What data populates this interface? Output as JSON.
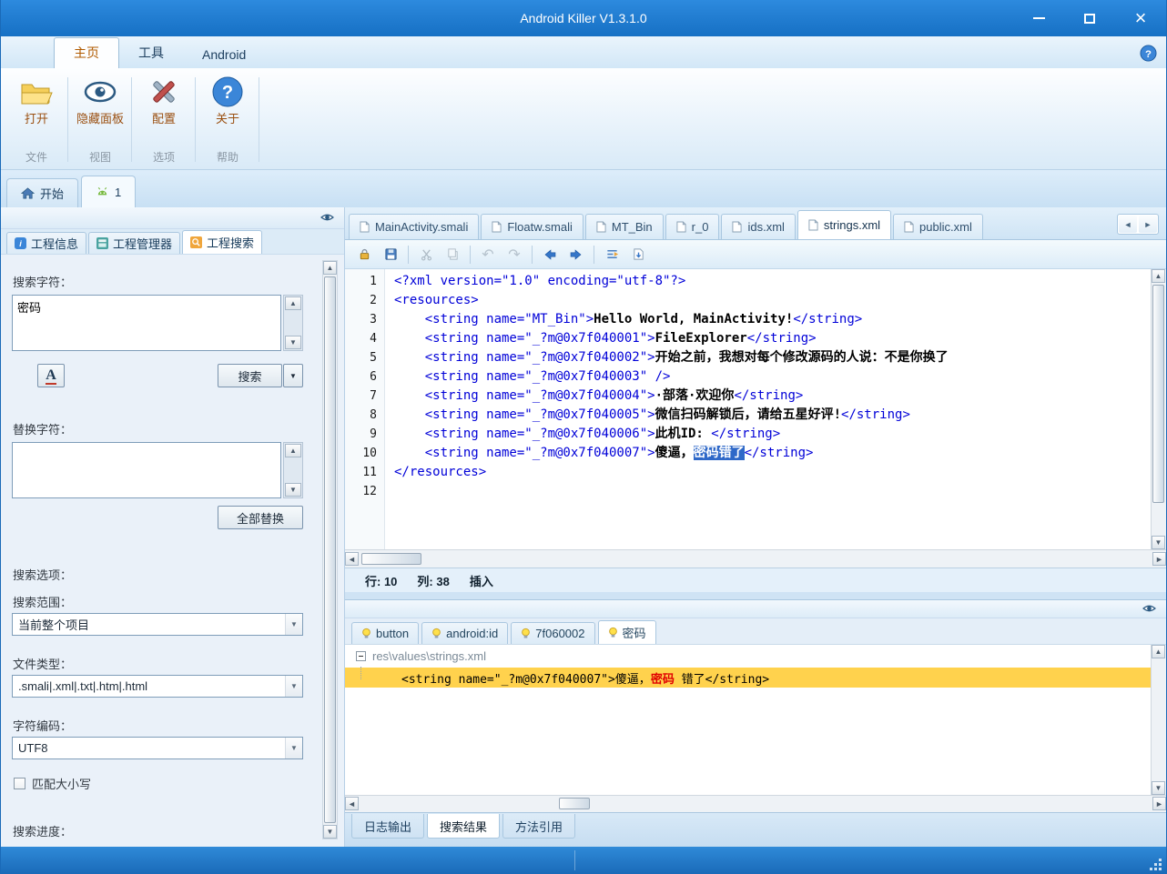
{
  "window": {
    "title": "Android Killer V1.3.1.0"
  },
  "ribbon": {
    "tabs": [
      {
        "label": "主页"
      },
      {
        "label": "工具"
      },
      {
        "label": "Android"
      }
    ],
    "buttons": [
      {
        "label": "打开",
        "group": "文件"
      },
      {
        "label": "隐藏面板",
        "group": "视图"
      },
      {
        "label": "配置",
        "group": "选项"
      },
      {
        "label": "关于",
        "group": "帮助"
      }
    ]
  },
  "doc_tabs": {
    "start_label": "开始",
    "project_label": "1"
  },
  "sidebar": {
    "tabs": [
      {
        "label": "工程信息"
      },
      {
        "label": "工程管理器"
      },
      {
        "label": "工程搜索"
      }
    ],
    "search": {
      "label": "搜索字符：",
      "value": "密码",
      "button": "搜索"
    },
    "replace": {
      "label": "替换字符：",
      "value": "",
      "button": "全部替换"
    },
    "options": {
      "label": "搜索选项：",
      "scope_label": "搜索范围：",
      "scope_value": "当前整个项目",
      "filetype_label": "文件类型：",
      "filetype_value": ".smali|.xml|.txt|.htm|.html",
      "encoding_label": "字符编码：",
      "encoding_value": "UTF8",
      "match_case": "匹配大小写",
      "progress_label": "搜索进度："
    }
  },
  "editor": {
    "file_tabs": [
      {
        "label": "MainActivity.smali"
      },
      {
        "label": "Floatw.smali"
      },
      {
        "label": "MT_Bin"
      },
      {
        "label": "r_0"
      },
      {
        "label": "ids.xml"
      },
      {
        "label": "strings.xml"
      },
      {
        "label": "public.xml"
      }
    ],
    "code_lines": [
      {
        "n": "1",
        "segs": [
          {
            "c": "tag",
            "t": "<?xml version=\"1.0\" encoding=\"utf-8\"?>"
          }
        ]
      },
      {
        "n": "2",
        "segs": [
          {
            "c": "tag",
            "t": "<resources>"
          }
        ]
      },
      {
        "n": "3",
        "segs": [
          {
            "c": "tag",
            "t": "    <string name=\"MT_Bin\">"
          },
          {
            "c": "txt",
            "t": "Hello World, MainActivity!"
          },
          {
            "c": "tag",
            "t": "</string>"
          }
        ]
      },
      {
        "n": "4",
        "segs": [
          {
            "c": "tag",
            "t": "    <string name=\"_?m@0x7f040001\">"
          },
          {
            "c": "txt",
            "t": "FileExplorer"
          },
          {
            "c": "tag",
            "t": "</string>"
          }
        ]
      },
      {
        "n": "5",
        "segs": [
          {
            "c": "tag",
            "t": "    <string name=\"_?m@0x7f040002\">"
          },
          {
            "c": "txt",
            "t": "开始之前，我想对每个修改源码的人说：不是你换了"
          }
        ]
      },
      {
        "n": "6",
        "segs": [
          {
            "c": "tag",
            "t": "    <string name=\"_?m@0x7f040003\" />"
          }
        ]
      },
      {
        "n": "7",
        "segs": [
          {
            "c": "tag",
            "t": "    <string name=\"_?m@0x7f040004\">"
          },
          {
            "c": "txt",
            "t": "·部落·欢迎你"
          },
          {
            "c": "tag",
            "t": "</string>"
          }
        ]
      },
      {
        "n": "8",
        "segs": [
          {
            "c": "tag",
            "t": "    <string name=\"_?m@0x7f040005\">"
          },
          {
            "c": "txt",
            "t": "微信扫码解锁后，请给五星好评!"
          },
          {
            "c": "tag",
            "t": "</string>"
          }
        ]
      },
      {
        "n": "9",
        "segs": [
          {
            "c": "tag",
            "t": "    <string name=\"_?m@0x7f040006\">"
          },
          {
            "c": "txt",
            "t": "此机ID: "
          },
          {
            "c": "tag",
            "t": "</string>"
          }
        ]
      },
      {
        "n": "10",
        "segs": [
          {
            "c": "tag",
            "t": "    <string name=\"_?m@0x7f040007\">"
          },
          {
            "c": "txt",
            "t": "傻逼，"
          },
          {
            "c": "sel",
            "t": "密码错了"
          },
          {
            "c": "tag",
            "t": "</string>"
          }
        ]
      },
      {
        "n": "11",
        "segs": [
          {
            "c": "tag",
            "t": "</resources>"
          }
        ]
      },
      {
        "n": "12",
        "segs": []
      }
    ],
    "status": {
      "line": "行: 10",
      "col": "列: 38",
      "mode": "插入"
    }
  },
  "results": {
    "tabs": [
      {
        "label": "button"
      },
      {
        "label": "android:id"
      },
      {
        "label": "7f060002"
      },
      {
        "label": "密码"
      }
    ],
    "tree_root": "res\\values\\strings.xml",
    "match": {
      "prefix": "<string name=\"_?m@0x7f040007\">傻逼，",
      "hit": "密码",
      "suffix": " 错了</string>"
    }
  },
  "bottom_tabs": [
    {
      "label": "日志输出"
    },
    {
      "label": "搜索结果"
    },
    {
      "label": "方法引用"
    }
  ]
}
